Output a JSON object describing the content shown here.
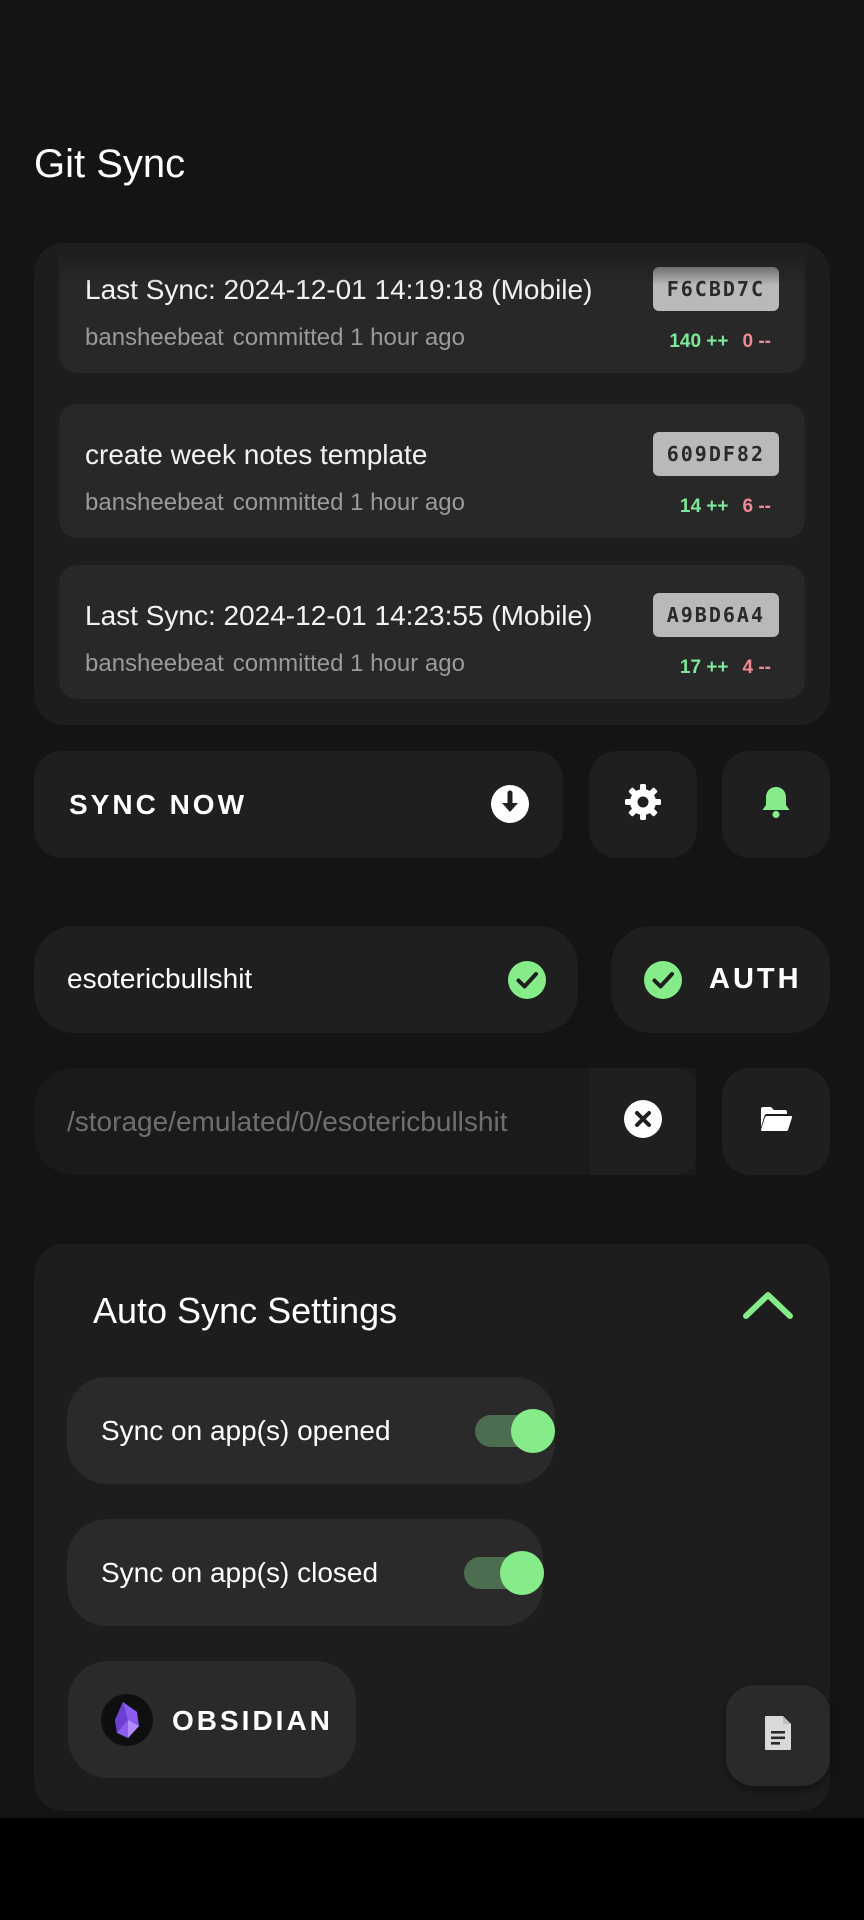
{
  "app": {
    "title": "Git Sync"
  },
  "commits": [
    {
      "message": "Last Sync: 2024-12-01 14:19:18 (Mobile)",
      "author": "bansheebeat",
      "when": "committed 1 hour ago",
      "sha": "F6CBD7C",
      "additions": "140 ++",
      "deletions": "0 --"
    },
    {
      "message": "create week notes template",
      "author": "bansheebeat",
      "when": "committed 1 hour ago",
      "sha": "609DF82",
      "additions": "14 ++",
      "deletions": "6 --"
    },
    {
      "message": "Last Sync: 2024-12-01 14:23:55 (Mobile)",
      "author": "bansheebeat",
      "when": "committed 1 hour ago",
      "sha": "A9BD6A4",
      "additions": "17 ++",
      "deletions": "4 --"
    }
  ],
  "actions": {
    "sync_now_label": "SYNC NOW"
  },
  "repo": {
    "name": "esotericbullshit",
    "auth_label": "AUTH"
  },
  "path": {
    "value": "/storage/emulated/0/esotericbullshit"
  },
  "auto_sync": {
    "title": "Auto Sync Settings",
    "on_opened": {
      "label": "Sync on app(s) opened",
      "enabled": true
    },
    "on_closed": {
      "label": "Sync on app(s) closed",
      "enabled": true
    },
    "app_label": "OBSIDIAN"
  },
  "colors": {
    "accent": "#86ec8a",
    "additions": "#7de89b",
    "deletions": "#f08a96",
    "background": "#141414"
  },
  "icons": [
    "download-circle-icon",
    "gear-icon",
    "bell-icon",
    "check-circle-icon",
    "close-circle-icon",
    "folder-open-icon",
    "chevron-up-icon",
    "obsidian-logo-icon",
    "document-icon"
  ]
}
